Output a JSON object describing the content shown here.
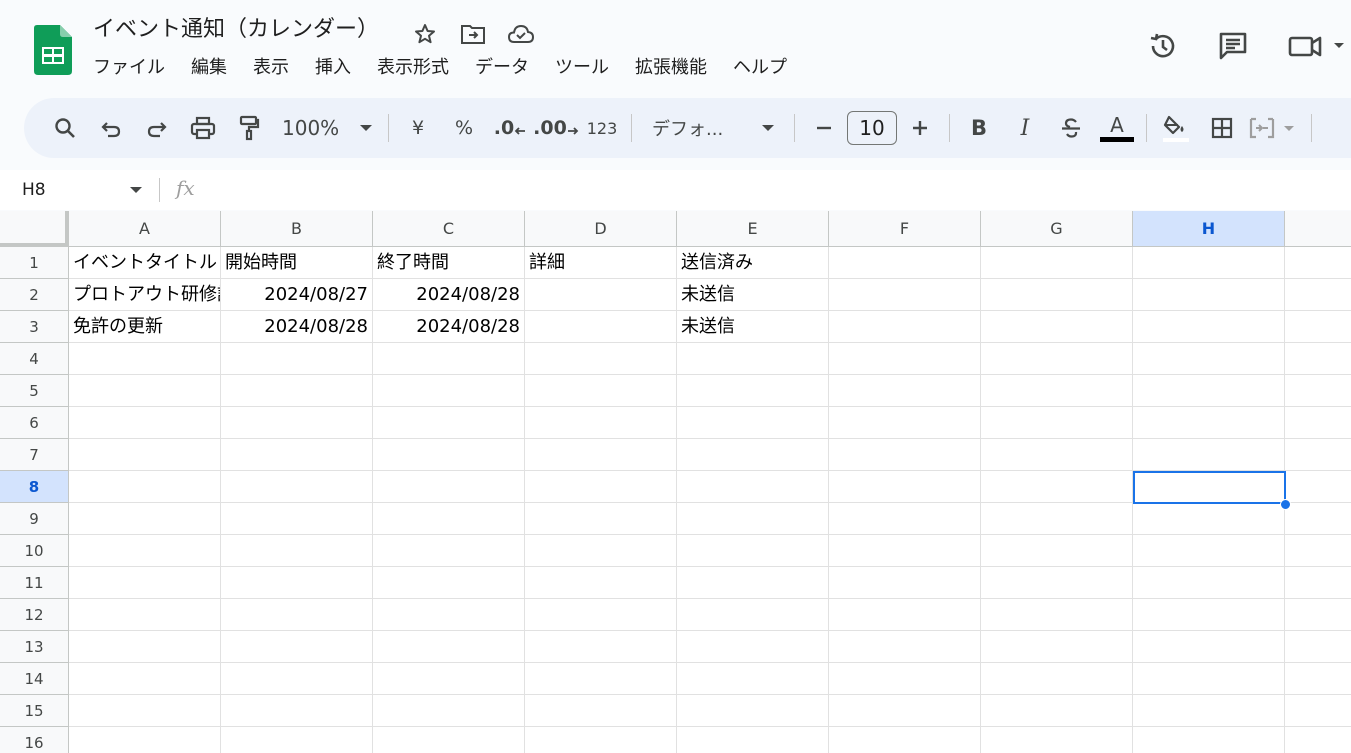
{
  "header": {
    "title": "イベント通知（カレンダー）",
    "menu": [
      "ファイル",
      "編集",
      "表示",
      "挿入",
      "表示形式",
      "データ",
      "ツール",
      "拡張機能",
      "ヘルプ"
    ]
  },
  "toolbar": {
    "zoom": "100%",
    "currency": "¥",
    "percent": "%",
    "dec_decrease": ".0",
    "dec_increase": ".00",
    "number_format": "123",
    "font": "デフォ...",
    "font_size": "10",
    "bold": "B",
    "italic": "I",
    "text_color": "A"
  },
  "formula_bar": {
    "name_box": "H8",
    "fx": "fx",
    "content": ""
  },
  "sheet": {
    "columns": [
      "A",
      "B",
      "C",
      "D",
      "E",
      "F",
      "G",
      "H"
    ],
    "rows": [
      "1",
      "2",
      "3",
      "4",
      "5",
      "6",
      "7",
      "8",
      "9",
      "10",
      "11",
      "12",
      "13",
      "14",
      "15",
      "16"
    ],
    "selected_cell": "H8",
    "data": [
      [
        "イベントタイトル",
        "開始時間",
        "終了時間",
        "詳細",
        "送信済み",
        "",
        "",
        ""
      ],
      [
        "プロトアウト研修課",
        "2024/08/27",
        "2024/08/28",
        "",
        "未送信",
        "",
        "",
        ""
      ],
      [
        "免許の更新",
        "2024/08/28",
        "2024/08/28",
        "",
        "未送信",
        "",
        "",
        ""
      ]
    ]
  },
  "colors": {
    "accent": "#1a73e8",
    "sheets_green": "#0f9d58",
    "toolbar_bg": "#edf2fa",
    "header_selected": "#d3e3fd"
  }
}
